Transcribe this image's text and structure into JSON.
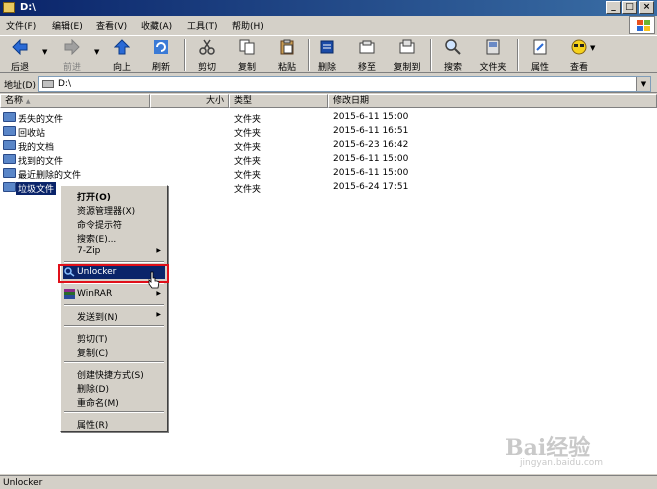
{
  "window": {
    "title": "D:\\",
    "minimize": "_",
    "maximize": "□",
    "close": "×"
  },
  "menu": [
    "文件(F)",
    "编辑(E)",
    "查看(V)",
    "收藏(A)",
    "工具(T)",
    "帮助(H)"
  ],
  "toolbar": {
    "back": "后退",
    "forward": "前进",
    "up": "向上",
    "refresh": "刷新",
    "cut": "剪切",
    "copy": "复制",
    "paste": "粘贴",
    "delete": "删除",
    "move_to": "移至",
    "copy_to": "复制到",
    "search": "搜索",
    "folders": "文件夹",
    "properties": "属性",
    "views": "查看"
  },
  "address": {
    "label": "地址(D)",
    "value": "D:\\"
  },
  "columns": {
    "name": "名称",
    "size": "大小",
    "type": "类型",
    "modified": "修改日期"
  },
  "files": [
    {
      "name": "丢失的文件",
      "type": "文件夹",
      "modified": "2015-6-11 15:00"
    },
    {
      "name": "回收站",
      "type": "文件夹",
      "modified": "2015-6-11 16:51"
    },
    {
      "name": "我的文档",
      "type": "文件夹",
      "modified": "2015-6-23 16:42"
    },
    {
      "name": "找到的文件",
      "type": "文件夹",
      "modified": "2015-6-11 15:00"
    },
    {
      "name": "最近删除的文件",
      "type": "文件夹",
      "modified": "2015-6-11 15:00"
    },
    {
      "name": "垃圾文件",
      "type": "文件夹",
      "modified": "2015-6-24 17:51"
    }
  ],
  "context_menu": {
    "open": "打开(O)",
    "explorer": "资源管理器(X)",
    "cmd": "命令提示符",
    "search": "搜索(E)...",
    "zip": "7-Zip",
    "unlocker": "Unlocker",
    "winrar": "WinRAR",
    "send_to": "发送到(N)",
    "cut": "剪切(T)",
    "copy": "复制(C)",
    "shortcut": "创建快捷方式(S)",
    "delete": "删除(D)",
    "rename": "重命名(M)",
    "properties": "属性(R)"
  },
  "status": {
    "text": "Unlocker"
  },
  "watermark": {
    "main": "Bai经验",
    "sub": "jingyan.baidu.com"
  },
  "colors": {
    "selection": "#0a246a",
    "highlight_box": "#e0101a",
    "title_gradient_start": "#0a246a"
  }
}
